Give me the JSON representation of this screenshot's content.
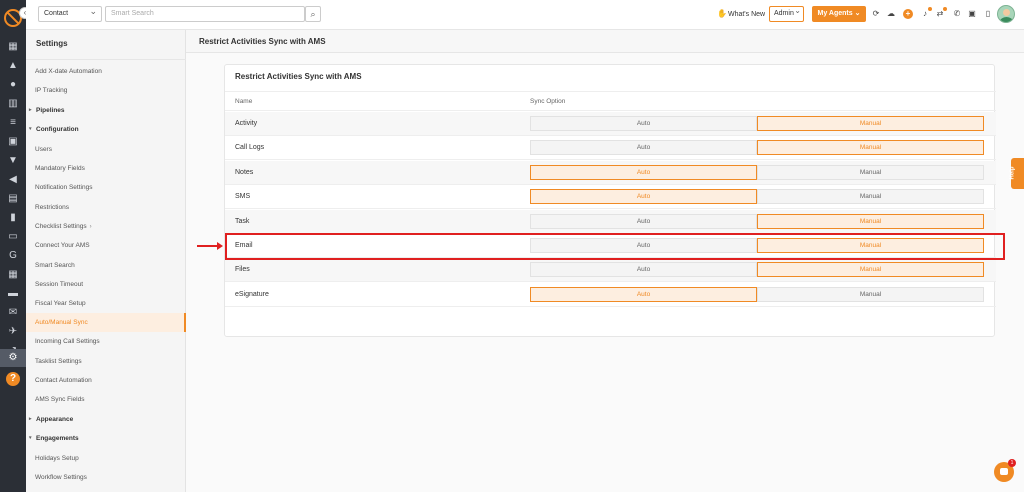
{
  "topbar": {
    "context_select": "Contact",
    "search_placeholder": "Smart Search",
    "whats_new": "What's New",
    "role_select": "Admin",
    "my_agents": "My Agents",
    "icons": [
      "sync-icon",
      "cloud-icon",
      "plus-icon",
      "bell-icon",
      "transfer-icon",
      "phone-icon",
      "chip-icon",
      "device-icon"
    ]
  },
  "rail": {
    "icons": [
      "dashboard-icon",
      "contacts-icon",
      "people-icon",
      "bank-icon",
      "list-icon",
      "calendar-icon",
      "filter-icon",
      "megaphone-icon",
      "document-icon",
      "reports-icon",
      "folder-icon",
      "google-icon",
      "calculator-icon",
      "briefcase-icon",
      "mail-icon",
      "plane-icon",
      "chart-icon",
      "settings-icon",
      "help-icon"
    ]
  },
  "sidebar": {
    "title": "Settings",
    "items": [
      {
        "label": "Add X-date Automation",
        "type": "item"
      },
      {
        "label": "IP Tracking",
        "type": "item"
      },
      {
        "label": "Pipelines",
        "type": "group"
      },
      {
        "label": "Configuration",
        "type": "group"
      },
      {
        "label": "Users",
        "type": "item"
      },
      {
        "label": "Mandatory Fields",
        "type": "item"
      },
      {
        "label": "Notification Settings",
        "type": "item"
      },
      {
        "label": "Restrictions",
        "type": "item"
      },
      {
        "label": "Checklist Settings",
        "type": "item"
      },
      {
        "label": "Connect Your AMS",
        "type": "item"
      },
      {
        "label": "Smart Search",
        "type": "item"
      },
      {
        "label": "Session Timeout",
        "type": "item"
      },
      {
        "label": "Fiscal Year Setup",
        "type": "item"
      },
      {
        "label": "Auto/Manual Sync",
        "type": "item"
      },
      {
        "label": "Incoming Call Settings",
        "type": "item"
      },
      {
        "label": "Tasklist Settings",
        "type": "item"
      },
      {
        "label": "Contact Automation",
        "type": "item"
      },
      {
        "label": "AMS Sync Fields",
        "type": "item"
      },
      {
        "label": "Appearance",
        "type": "group"
      },
      {
        "label": "Engagements",
        "type": "group"
      },
      {
        "label": "Holidays Setup",
        "type": "item"
      },
      {
        "label": "Workflow Settings",
        "type": "item"
      }
    ]
  },
  "main": {
    "page_title": "Restrict Activities Sync with AMS",
    "card_title": "Restrict Activities Sync with AMS",
    "col_name": "Name",
    "col_sync": "Sync Option",
    "auto_label": "Auto",
    "manual_label": "Manual",
    "rows": [
      {
        "name": "Activity",
        "selected": "Manual"
      },
      {
        "name": "Call Logs",
        "selected": "Manual"
      },
      {
        "name": "Notes",
        "selected": "Auto"
      },
      {
        "name": "SMS",
        "selected": "Auto"
      },
      {
        "name": "Task",
        "selected": "Manual"
      },
      {
        "name": "Email",
        "selected": "Manual"
      },
      {
        "name": "Files",
        "selected": "Manual"
      },
      {
        "name": "eSignature",
        "selected": "Auto"
      }
    ]
  },
  "help_tab": "Help",
  "chat_badge": "1",
  "colors": {
    "accent": "#f08a24",
    "highlight": "#e02020",
    "rail": "#2b2f36"
  }
}
